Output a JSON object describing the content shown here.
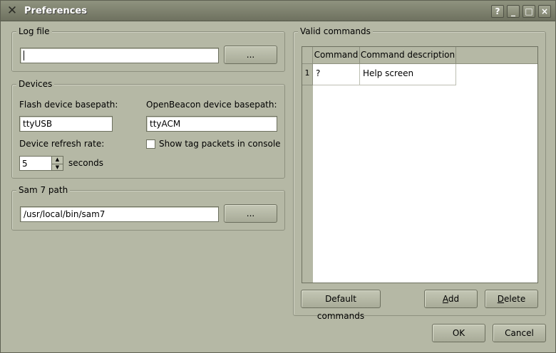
{
  "window": {
    "title": "Preferences",
    "title_buttons": {
      "help": "?",
      "minimize": "_",
      "maximize": "□",
      "close": "×"
    }
  },
  "log_file": {
    "group_title": "Log file",
    "path_value": "",
    "browse_label": "..."
  },
  "devices": {
    "group_title": "Devices",
    "flash_label": "Flash device basepath:",
    "flash_value": "ttyUSB",
    "openbeacon_label": "OpenBeacon device basepath:",
    "openbeacon_value": "ttyACM",
    "refresh_label": "Device refresh rate:",
    "refresh_value": "5",
    "refresh_unit": "seconds",
    "show_packets_label": "Show tag packets in console",
    "show_packets_checked": false
  },
  "sam7": {
    "group_title": "Sam 7 path",
    "path_value": "/usr/local/bin/sam7",
    "browse_label": "..."
  },
  "commands": {
    "group_title": "Valid commands",
    "columns": [
      "Command",
      "Command description"
    ],
    "rows": [
      {
        "index": "1",
        "command": "?",
        "description": "Help screen"
      }
    ],
    "default_label": "Default commands",
    "add_label_pre": "",
    "add_label_u": "A",
    "add_label_post": "dd",
    "delete_label_pre": "",
    "delete_label_u": "D",
    "delete_label_post": "elete"
  },
  "dialog": {
    "ok_label": "OK",
    "cancel_label": "Cancel"
  }
}
